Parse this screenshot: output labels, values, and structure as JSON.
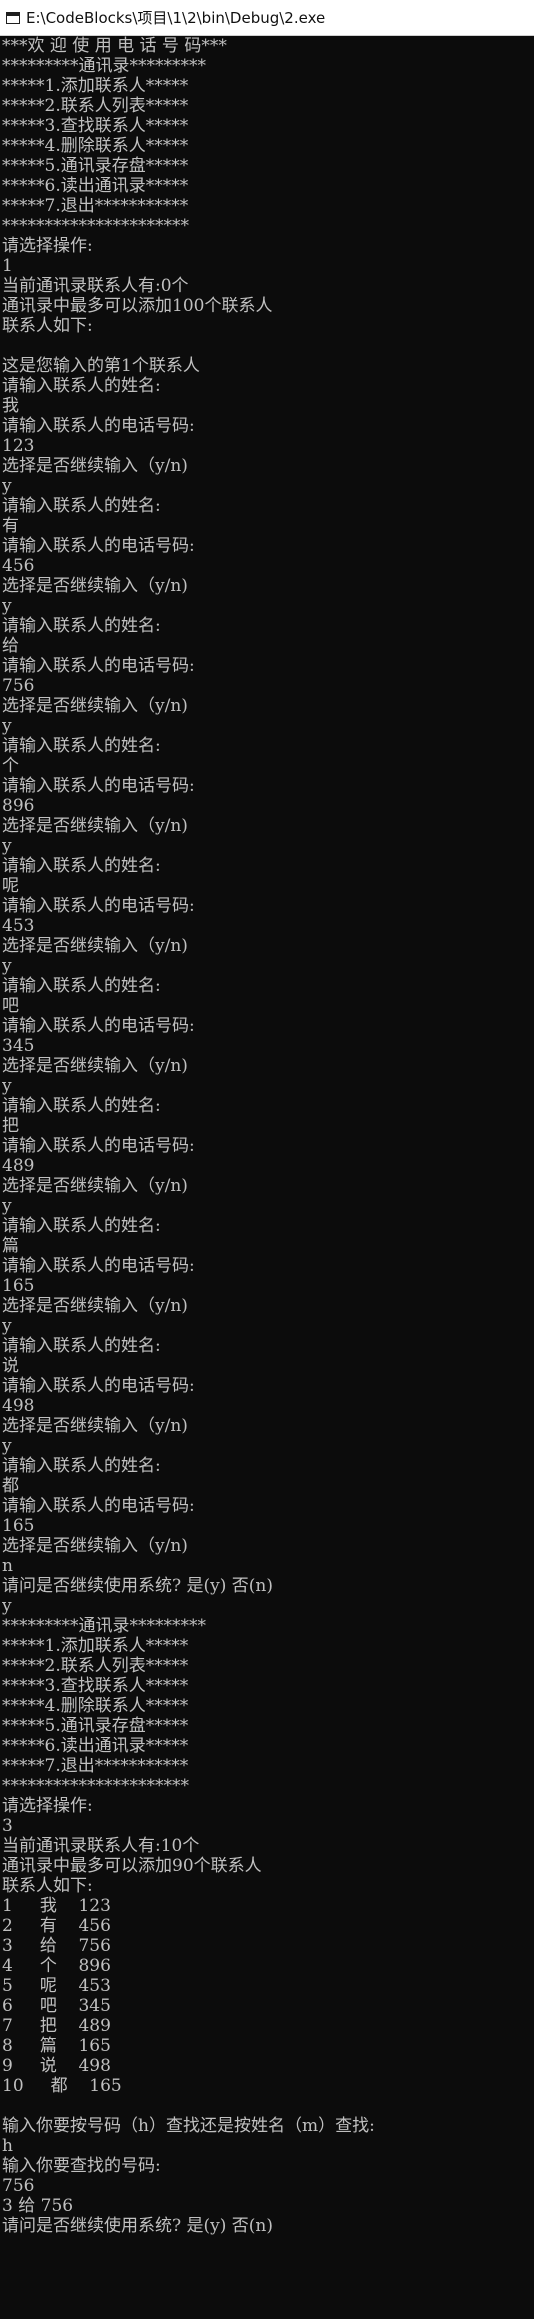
{
  "window": {
    "title": "E:\\CodeBlocks\\项目\\1\\2\\bin\\Debug\\2.exe",
    "icon": "console-app-icon"
  },
  "console": {
    "lines": [
      "***欢 迎 使 用 电 话 号 码***",
      "*********通讯录*********",
      "*****1.添加联系人*****",
      "*****2.联系人列表*****",
      "*****3.查找联系人*****",
      "*****4.删除联系人*****",
      "*****5.通讯录存盘*****",
      "*****6.读出通讯录*****",
      "*****7.退出***********",
      "**********************",
      "请选择操作:",
      "1",
      "当前通讯录联系人有:0个",
      "通讯录中最多可以添加100个联系人",
      "联系人如下:",
      "",
      "这是您输入的第1个联系人",
      "请输入联系人的姓名:",
      "我",
      "请输入联系人的电话号码:",
      "123",
      "选择是否继续输入（y/n)",
      "y",
      "请输入联系人的姓名:",
      "有",
      "请输入联系人的电话号码:",
      "456",
      "选择是否继续输入（y/n)",
      "y",
      "请输入联系人的姓名:",
      "给",
      "请输入联系人的电话号码:",
      "756",
      "选择是否继续输入（y/n)",
      "y",
      "请输入联系人的姓名:",
      "个",
      "请输入联系人的电话号码:",
      "896",
      "选择是否继续输入（y/n)",
      "y",
      "请输入联系人的姓名:",
      "呢",
      "请输入联系人的电话号码:",
      "453",
      "选择是否继续输入（y/n)",
      "y",
      "请输入联系人的姓名:",
      "吧",
      "请输入联系人的电话号码:",
      "345",
      "选择是否继续输入（y/n)",
      "y",
      "请输入联系人的姓名:",
      "把",
      "请输入联系人的电话号码:",
      "489",
      "选择是否继续输入（y/n)",
      "y",
      "请输入联系人的姓名:",
      "篇",
      "请输入联系人的电话号码:",
      "165",
      "选择是否继续输入（y/n)",
      "y",
      "请输入联系人的姓名:",
      "说",
      "请输入联系人的电话号码:",
      "498",
      "选择是否继续输入（y/n)",
      "y",
      "请输入联系人的姓名:",
      "都",
      "请输入联系人的电话号码:",
      "165",
      "选择是否继续输入（y/n)",
      "n",
      "请问是否继续使用系统? 是(y) 否(n)",
      "y",
      "*********通讯录*********",
      "*****1.添加联系人*****",
      "*****2.联系人列表*****",
      "*****3.查找联系人*****",
      "*****4.删除联系人*****",
      "*****5.通讯录存盘*****",
      "*****6.读出通讯录*****",
      "*****7.退出***********",
      "**********************",
      "请选择操作:",
      "3",
      "当前通讯录联系人有:10个",
      "通讯录中最多可以添加90个联系人",
      "联系人如下:",
      "1     我    123",
      "2     有    456",
      "3     给    756",
      "4     个    896",
      "5     呢    453",
      "6     吧    345",
      "7     把    489",
      "8     篇    165",
      "9     说    498",
      "10     都    165",
      "",
      "输入你要按号码（h）查找还是按姓名（m）查找:",
      "h",
      "输入你要查找的号码:",
      "756",
      "3 给 756",
      "请问是否继续使用系统? 是(y) 否(n)"
    ]
  }
}
